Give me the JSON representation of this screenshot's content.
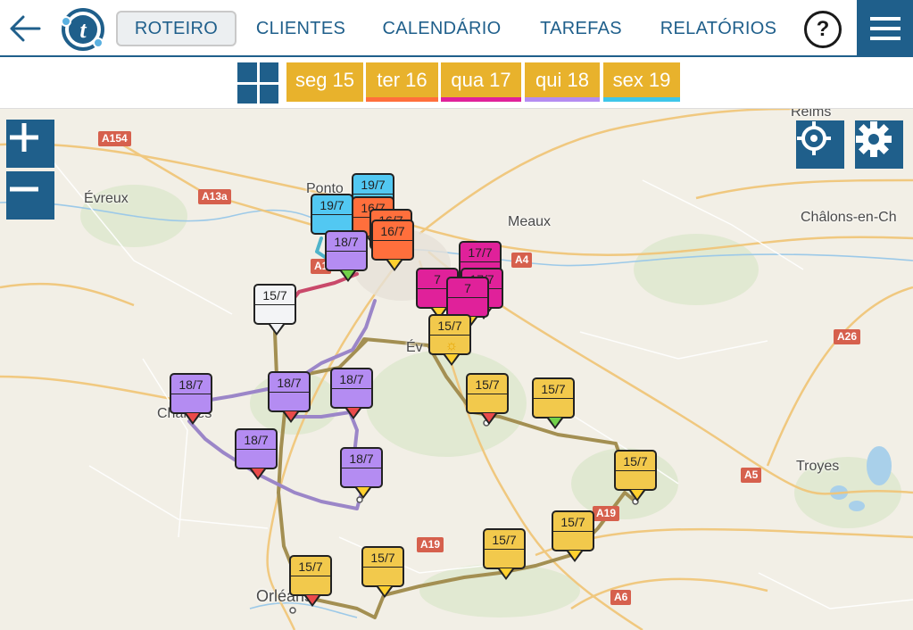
{
  "nav": {
    "back_icon": "arrow-left-icon",
    "logo_letter": "t",
    "tabs": [
      {
        "id": "roteiro",
        "label": "ROTEIRO",
        "active": true
      },
      {
        "id": "clientes",
        "label": "CLIENTES"
      },
      {
        "id": "calendario",
        "label": "CALENDÁRIO"
      },
      {
        "id": "tarefas",
        "label": "TAREFAS"
      },
      {
        "id": "relatorios",
        "label": "RELATÓRIOS"
      }
    ],
    "help_label": "?",
    "menu_icon": "hamburger-icon"
  },
  "days": [
    {
      "label": "seg 15",
      "underline": "#e8b22c"
    },
    {
      "label": "ter 16",
      "underline": "#ff6f3c"
    },
    {
      "label": "qua 17",
      "underline": "#e0219a"
    },
    {
      "label": "qui 18",
      "underline": "#b48cf2"
    },
    {
      "label": "sex 19",
      "underline": "#3ec6ea"
    }
  ],
  "colors": {
    "primary": "#1f5f8b",
    "day15": "#f2c94c",
    "day16": "#ff6f3c",
    "day17": "#e0219a",
    "day18": "#b48cf2",
    "day19": "#52c8f2",
    "unassigned": "#f3f4f6"
  },
  "map": {
    "cities": [
      "Reims",
      "Évreux",
      "Ponto",
      "Meaux",
      "Châlons-en-Ch",
      "Chartres",
      "Troyes",
      "Orléans",
      "Év"
    ],
    "roads": [
      "A154",
      "A13a",
      "A4",
      "A26",
      "A5",
      "A19",
      "A6",
      "A1",
      "A19"
    ],
    "controls": {
      "zoom_in": "+",
      "zoom_out": "−",
      "locate_icon": "crosshair-icon",
      "settings_icon": "gear-icon"
    },
    "markers": [
      {
        "date": "19/7",
        "color": "#52c8f2",
        "tip": "#ffd02e"
      },
      {
        "date": "19/7",
        "color": "#52c8f2",
        "tip": "#ffd02e"
      },
      {
        "date": "16/7",
        "color": "#ff6f3c",
        "tip": "#ffd02e"
      },
      {
        "date": "16/7",
        "color": "#ff6f3c",
        "tip": "#ffd02e"
      },
      {
        "date": "16/7",
        "color": "#ff6f3c",
        "tip": "#ffd02e"
      },
      {
        "date": "18/7",
        "color": "#b48cf2",
        "tip": "#72d14a"
      },
      {
        "date": "17/7",
        "color": "#e0219a",
        "tip": "#ffd02e"
      },
      {
        "date": "17/7",
        "color": "#e0219a",
        "tip": "#ffd02e"
      },
      {
        "date": "7",
        "color": "#e0219a",
        "tip": "#ffd02e"
      },
      {
        "date": "7",
        "color": "#e0219a",
        "tip": "#ffd02e"
      },
      {
        "date": "15/7",
        "color": "#f3f4f6",
        "tip": "#f3f4f6"
      },
      {
        "date": "15/7",
        "color": "#f2c94c",
        "tip": "#ffd02e"
      },
      {
        "date": "18/7",
        "color": "#b48cf2",
        "tip": "#ea4a4a"
      },
      {
        "date": "18/7",
        "color": "#b48cf2",
        "tip": "#ea4a4a"
      },
      {
        "date": "18/7",
        "color": "#b48cf2",
        "tip": "#ea4a4a"
      },
      {
        "date": "15/7",
        "color": "#f2c94c",
        "tip": "#ea4a4a"
      },
      {
        "date": "15/7",
        "color": "#f2c94c",
        "tip": "#72d14a"
      },
      {
        "date": "18/7",
        "color": "#b48cf2",
        "tip": "#ea4a4a"
      },
      {
        "date": "18/7",
        "color": "#b48cf2",
        "tip": "#ffd02e"
      },
      {
        "date": "15/7",
        "color": "#f2c94c",
        "tip": "#ffd02e"
      },
      {
        "date": "15/7",
        "color": "#f2c94c",
        "tip": "#ffd02e"
      },
      {
        "date": "15/7",
        "color": "#f2c94c",
        "tip": "#ffd02e"
      },
      {
        "date": "15/7",
        "color": "#f2c94c",
        "tip": "#ea4a4a"
      },
      {
        "date": "15/7",
        "color": "#f2c94c",
        "tip": "#ffd02e"
      }
    ]
  }
}
